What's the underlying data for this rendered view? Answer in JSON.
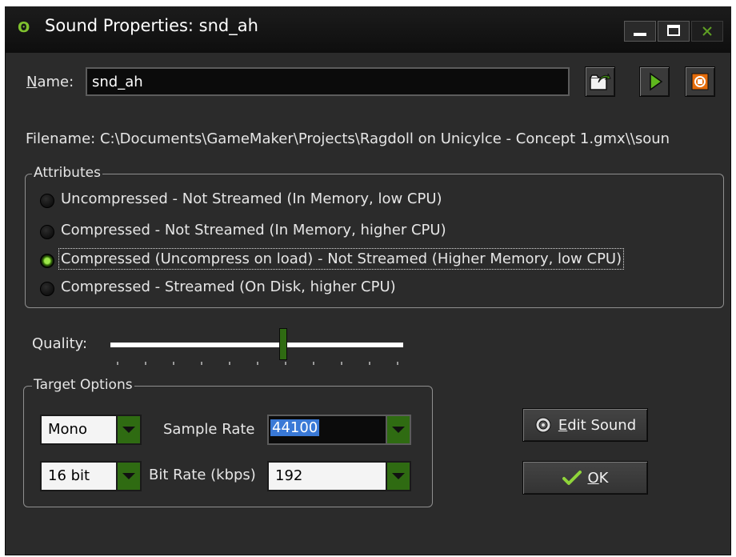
{
  "window": {
    "title": "Sound Properties: snd_ah",
    "app_icon_glyph": "ʘ",
    "accent_color": "#7fc12e"
  },
  "name": {
    "label_accel": "N",
    "label_rest": "ame:",
    "value": "snd_ah"
  },
  "toolbar": {
    "load_icon": "folder-open-icon",
    "play_icon": "play-icon",
    "stop_icon": "stop-icon"
  },
  "filename": "Filename: C:\\Documents\\GameMaker\\Projects\\Ragdoll on Unicylce - Concept 1.gmx\\\\soun",
  "attributes": {
    "legend": "Attributes",
    "options": [
      {
        "label": "Uncompressed - Not Streamed (In Memory, low CPU)",
        "selected": false
      },
      {
        "label": "Compressed - Not Streamed (In Memory, higher CPU)",
        "selected": false
      },
      {
        "label": "Compressed (Uncompress on load) - Not Streamed (Higher Memory, low CPU)",
        "selected": true
      },
      {
        "label": "Compressed - Streamed (On Disk, higher CPU)",
        "selected": false
      }
    ]
  },
  "quality": {
    "label": "Quality:",
    "value_fraction": 0.59,
    "tick_count": 11
  },
  "target": {
    "legend": "Target Options",
    "channels": "Mono",
    "sample_rate_label": "Sample Rate",
    "sample_rate": "44100",
    "bit_depth": "16 bit",
    "bit_rate_label": "Bit Rate (kbps)",
    "bit_rate": "192"
  },
  "buttons": {
    "edit_accel": "E",
    "edit_rest": "dit Sound",
    "ok_accel": "O",
    "ok_rest": "K"
  }
}
